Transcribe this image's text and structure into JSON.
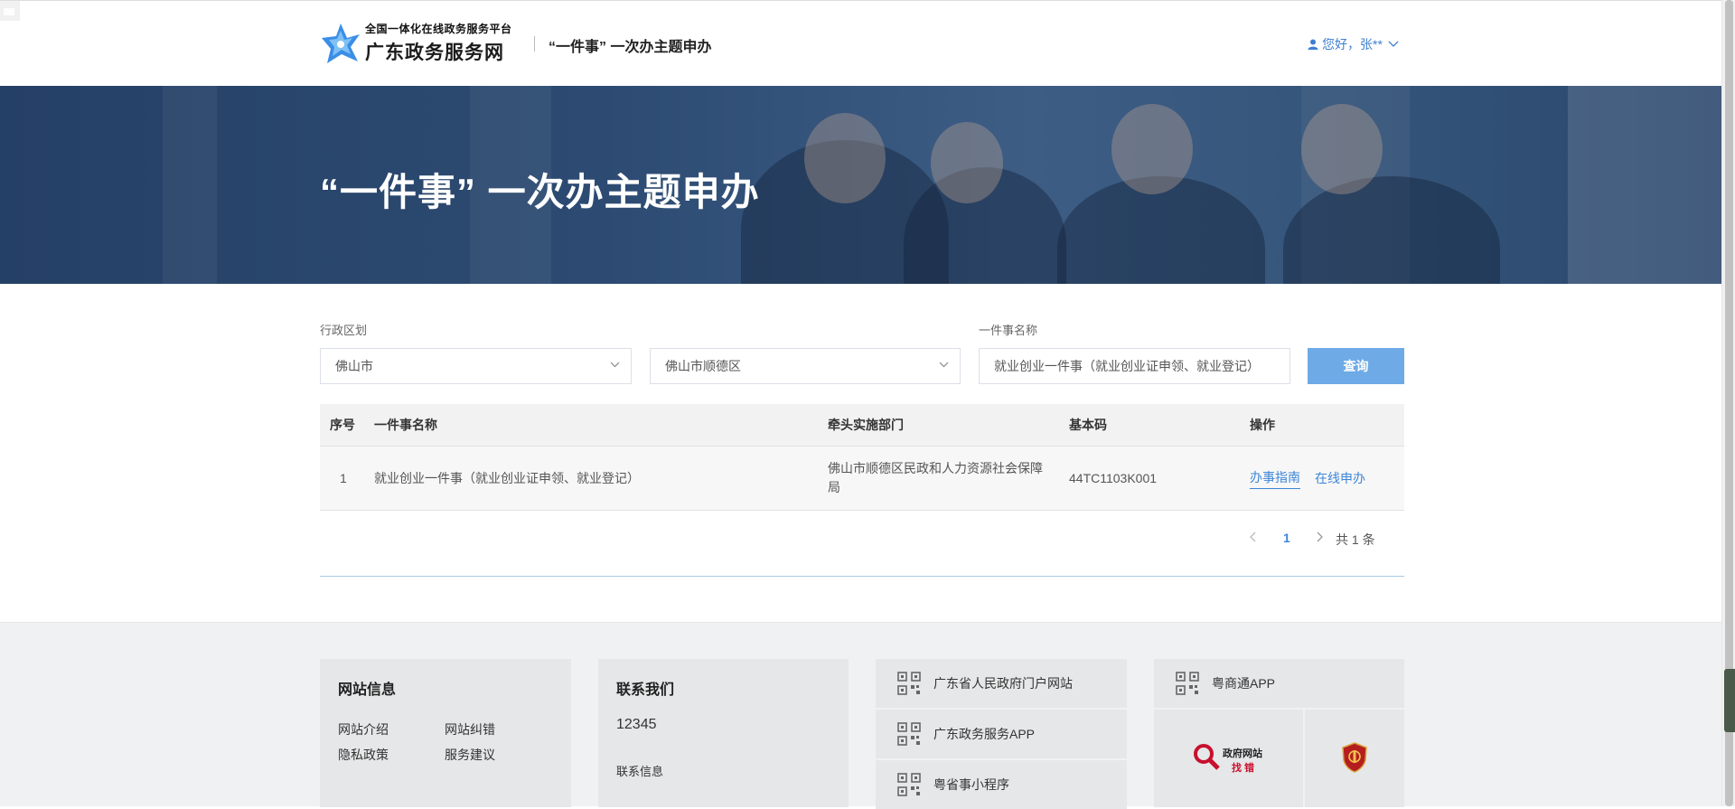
{
  "header": {
    "logo_sub": "全国一体化在线政务服务平台",
    "logo_main": "广东政务服务网",
    "title": "“一件事” 一次办主题申办",
    "user_greeting": "您好，张**"
  },
  "banner": {
    "title": "“一件事” 一次办主题申办"
  },
  "filters": {
    "region_label": "行政区划",
    "city_value": "佛山市",
    "district_value": "佛山市顺德区",
    "name_label": "一件事名称",
    "name_value": "就业创业一件事（就业创业证申领、就业登记）",
    "query_button": "查询"
  },
  "table": {
    "headers": [
      "序号",
      "一件事名称",
      "牵头实施部门",
      "基本码",
      "操作"
    ],
    "rows": [
      {
        "index": "1",
        "name": "就业创业一件事（就业创业证申领、就业登记）",
        "dept": "佛山市顺德区民政和人力资源社会保障局",
        "code": "44TC1103K001",
        "op_guide": "办事指南",
        "op_apply": "在线申办"
      }
    ]
  },
  "pagination": {
    "current_page": "1",
    "total": "共 1 条"
  },
  "footer": {
    "site_info": {
      "title": "网站信息",
      "links": [
        "网站介绍",
        "网站纠错",
        "隐私政策",
        "服务建议"
      ]
    },
    "contact": {
      "title": "联系我们",
      "phone": "12345",
      "info": "联系信息"
    },
    "qr_links": [
      "广东省人民政府门户网站",
      "广东政务服务APP",
      "粤省事小程序"
    ],
    "app_link": "粤商通APP",
    "badge_zhaocuo_line1": "政府网站",
    "badge_zhaocuo_line2": "找错"
  },
  "colors": {
    "accent": "#3d86d8",
    "query_button": "#6eaae6",
    "banner": "#2e4d73"
  }
}
